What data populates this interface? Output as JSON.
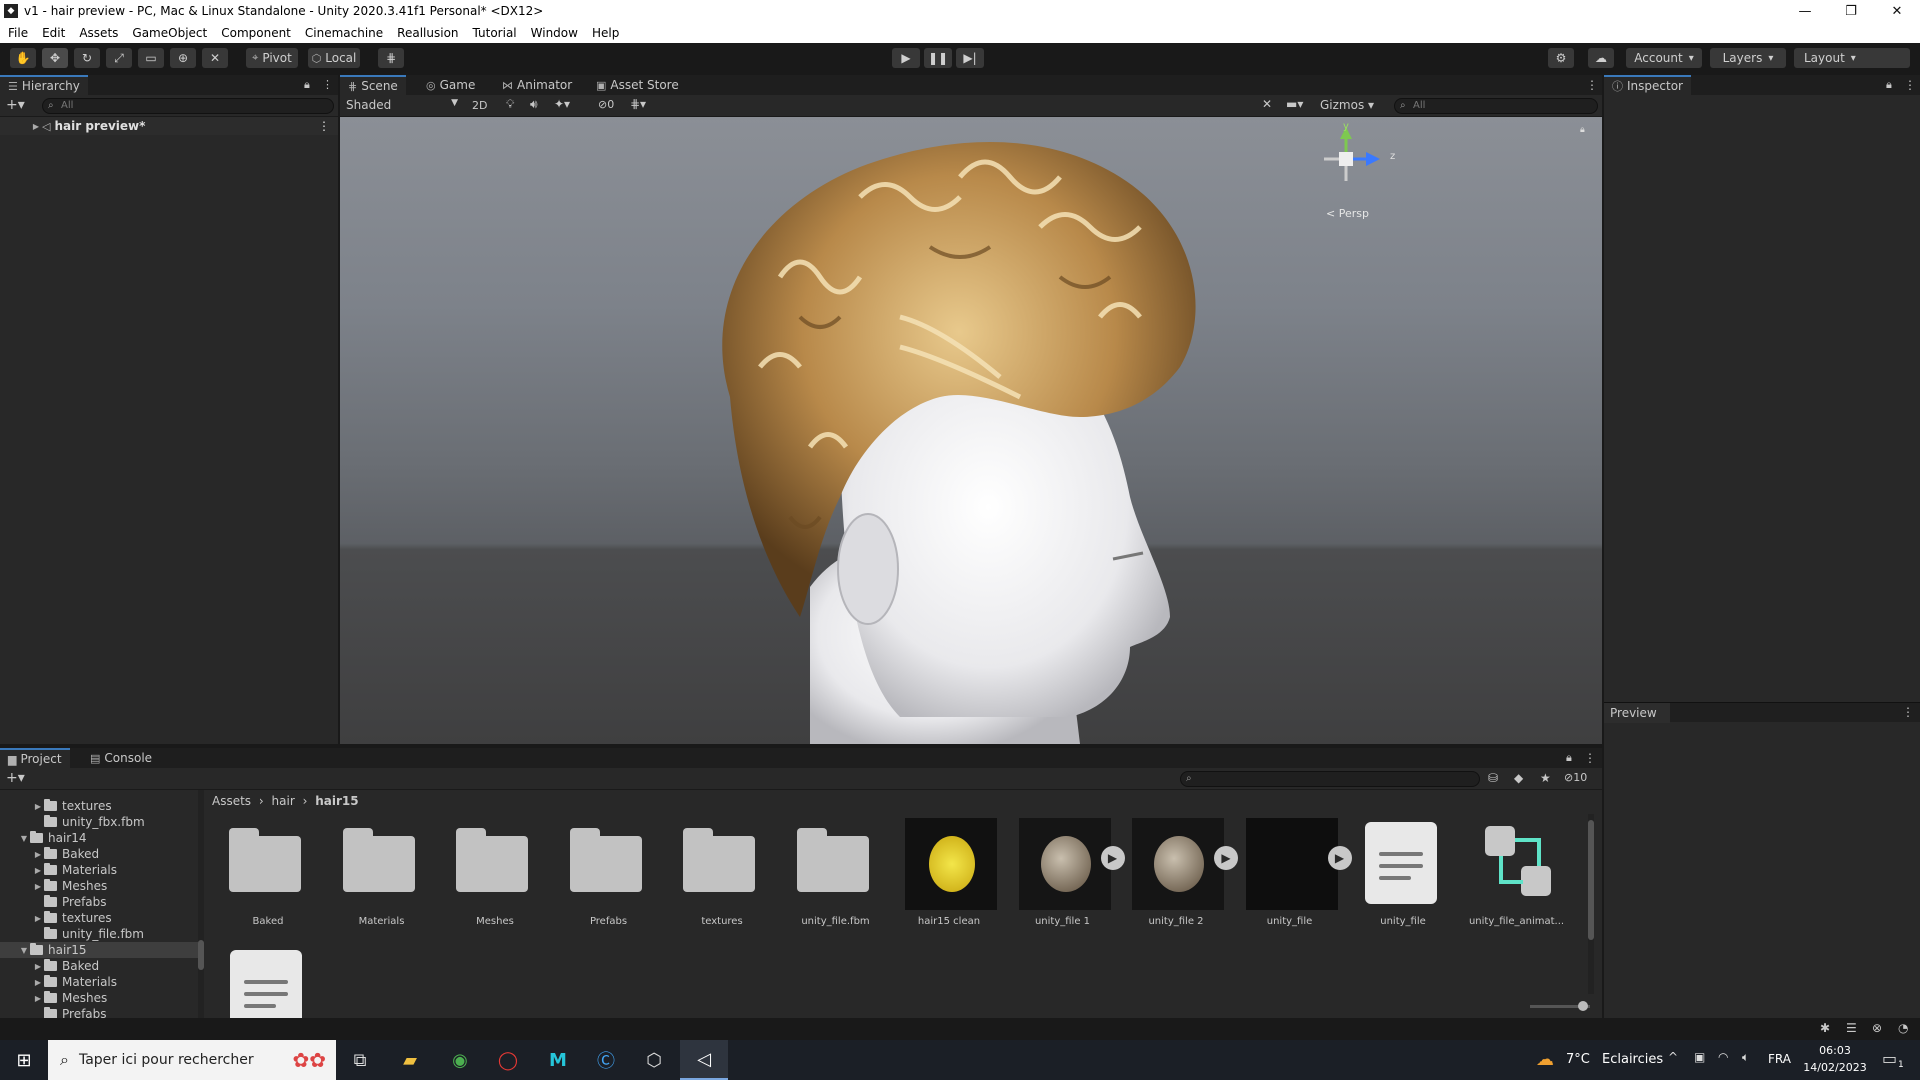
{
  "window": {
    "title": "v1 - hair preview - PC, Mac & Linux Standalone - Unity 2020.3.41f1 Personal* <DX12>"
  },
  "menu": [
    "File",
    "Edit",
    "Assets",
    "GameObject",
    "Component",
    "Cinemachine",
    "Reallusion",
    "Tutorial",
    "Window",
    "Help"
  ],
  "toolbar": {
    "pivot": "Pivot",
    "local": "Local",
    "account": "Account",
    "layers": "Layers",
    "layout": "Layout"
  },
  "hierarchy": {
    "tab": "Hierarchy",
    "search_placeholder": "All",
    "root_item": "hair preview*"
  },
  "scene": {
    "tabs": [
      "Scene",
      "Game",
      "Animator",
      "Asset Store"
    ],
    "shading": "Shaded",
    "mode_2d": "2D",
    "hidden_count": "0",
    "gizmos": "Gizmos",
    "search_placeholder": "All",
    "persp": "< Persp",
    "axis_y": "y",
    "axis_z": "z"
  },
  "inspector": {
    "tab": "Inspector",
    "preview": "Preview"
  },
  "project": {
    "tabs": [
      "Project",
      "Console"
    ],
    "hidden_count": "10",
    "breadcrumb": [
      "Assets",
      "hair",
      "hair15"
    ],
    "tree": [
      {
        "label": "textures",
        "indent": 2,
        "folder": true,
        "arrow": "▶"
      },
      {
        "label": "unity_fbx.fbm",
        "indent": 2,
        "folder": true,
        "arrow": ""
      },
      {
        "label": "hair14",
        "indent": 1,
        "folder": true,
        "arrow": "▼"
      },
      {
        "label": "Baked",
        "indent": 2,
        "folder": true,
        "arrow": "▶"
      },
      {
        "label": "Materials",
        "indent": 2,
        "folder": true,
        "arrow": "▶"
      },
      {
        "label": "Meshes",
        "indent": 2,
        "folder": true,
        "arrow": "▶"
      },
      {
        "label": "Prefabs",
        "indent": 2,
        "folder": true,
        "arrow": ""
      },
      {
        "label": "textures",
        "indent": 2,
        "folder": true,
        "arrow": "▶"
      },
      {
        "label": "unity_file.fbm",
        "indent": 2,
        "folder": true,
        "arrow": ""
      },
      {
        "label": "hair15",
        "indent": 1,
        "folder": true,
        "arrow": "▼",
        "selected": true
      },
      {
        "label": "Baked",
        "indent": 2,
        "folder": true,
        "arrow": "▶"
      },
      {
        "label": "Materials",
        "indent": 2,
        "folder": true,
        "arrow": "▶"
      },
      {
        "label": "Meshes",
        "indent": 2,
        "folder": true,
        "arrow": "▶"
      },
      {
        "label": "Prefabs",
        "indent": 2,
        "folder": true,
        "arrow": ""
      }
    ],
    "assets": [
      {
        "label": "Baked",
        "kind": "folder"
      },
      {
        "label": "Materials",
        "kind": "folder"
      },
      {
        "label": "Meshes",
        "kind": "folder"
      },
      {
        "label": "Prefabs",
        "kind": "folder"
      },
      {
        "label": "textures",
        "kind": "folder"
      },
      {
        "label": "unity_file.fbm",
        "kind": "folder"
      },
      {
        "label": "hair15 clean",
        "kind": "texture"
      },
      {
        "label": "unity_file 1",
        "kind": "model"
      },
      {
        "label": "unity_file 2",
        "kind": "model"
      },
      {
        "label": "unity_file",
        "kind": "model-dark"
      },
      {
        "label": "unity_file",
        "kind": "doc"
      },
      {
        "label": "unity_file_animat...",
        "kind": "anim"
      },
      {
        "label": "",
        "kind": "doc"
      }
    ]
  },
  "taskbar": {
    "search_placeholder": "Taper ici pour rechercher",
    "weather_temp": "7°C",
    "weather_text": "Eclaircies",
    "lang": "FRA",
    "time": "06:03",
    "date": "14/02/2023",
    "notifications": "1"
  },
  "colors": {
    "accent": "#3a79bb",
    "panel": "#282828",
    "toolbar": "#191919",
    "taskbar": "#1b1f26"
  }
}
